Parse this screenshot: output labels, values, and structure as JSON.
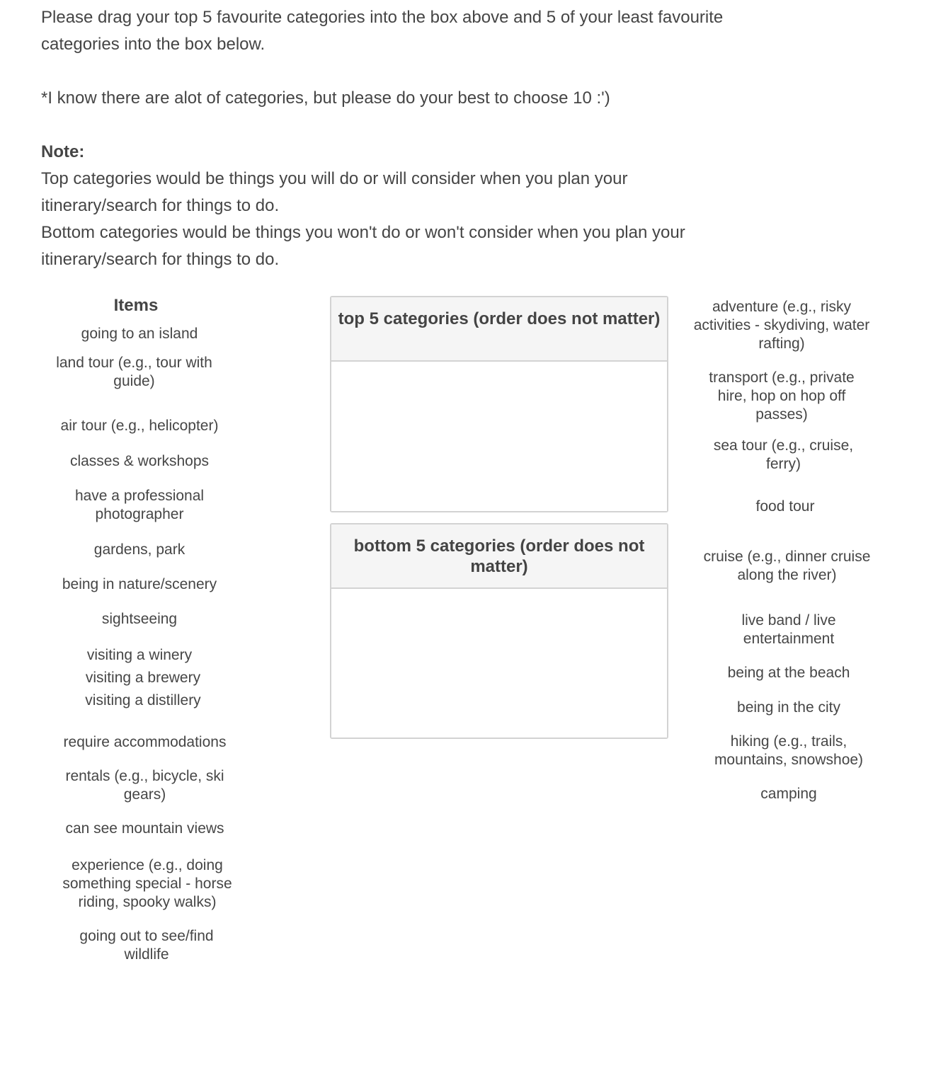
{
  "instructions": {
    "line1": "Please drag your top 5 favourite categories into the box above and 5 of your least favourite",
    "line2": "categories into the box below.",
    "line3": "*I know there are alot of categories, but please do your best to choose 10 :')",
    "note_heading": "Note:",
    "top_line1": "Top categories would be things you will do or will consider when you plan your",
    "top_line2": "itinerary/search for things to do.",
    "bottom_line1": "Bottom categories would be things you won't do or won't consider when you plan your",
    "bottom_line2": "itinerary/search for things to do."
  },
  "items_title": "Items",
  "left_items": [
    "going to an island",
    "land tour (e.g., tour with guide)",
    "air tour (e.g., helicopter)",
    "classes & workshops",
    "have a professional photographer",
    "gardens, park",
    "being in nature/scenery",
    "sightseeing",
    "visiting a winery",
    "visiting a brewery",
    "visiting a distillery",
    "require accommodations",
    "rentals (e.g., bicycle, ski gears)",
    "can see mountain views",
    "experience (e.g., doing something special - horse riding, spooky walks)",
    "going out to see/find wildlife"
  ],
  "right_items": [
    "adventure (e.g., risky activities - skydiving, water rafting)",
    "transport (e.g., private hire, hop on hop off passes)",
    "sea tour (e.g., cruise, ferry)",
    "food tour",
    "cruise (e.g., dinner cruise along the river)",
    "live band / live entertainment",
    "being at the beach",
    "being in the city",
    "hiking (e.g., trails, mountains, snowshoe)",
    "camping"
  ],
  "top_box": {
    "title": "top 5 categories (order does not matter)"
  },
  "bottom_box": {
    "title": "bottom 5 categories (order does not matter)"
  }
}
